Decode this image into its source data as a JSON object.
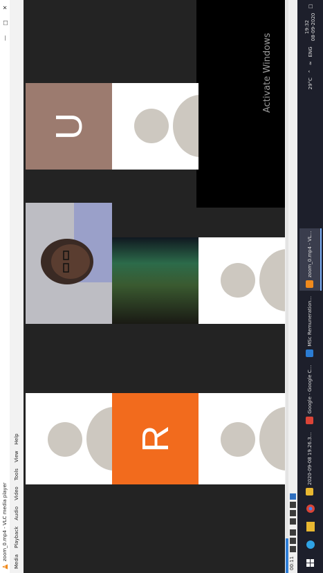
{
  "window": {
    "title": "zoom_0.mp4 - VLC media player"
  },
  "menu": [
    "Media",
    "Playback",
    "Audio",
    "Video",
    "Tools",
    "View",
    "Help"
  ],
  "participants": {
    "tile_r_letter": "R",
    "tile_u_letter": "U",
    "tile_r_color": "#f26b1d",
    "tile_u_color": "#9c7b6f"
  },
  "watermark": "Activate Windows",
  "player": {
    "elapsed": "00:11",
    "progress": 0.06
  },
  "taskbar": {
    "apps": [
      {
        "label": "2020-09-08 19.26.3...",
        "color": "#e8b731"
      },
      {
        "label": "Google - Google C...",
        "color": "#db4437"
      },
      {
        "label": "MSc Remuneration...",
        "color": "#2b7cd3"
      },
      {
        "label": "zoom_0.mp4 - VL...",
        "color": "#f08a1c"
      }
    ],
    "temperature": "29°C",
    "language": "ENG",
    "time": "19:32",
    "date": "08-09-2020"
  }
}
